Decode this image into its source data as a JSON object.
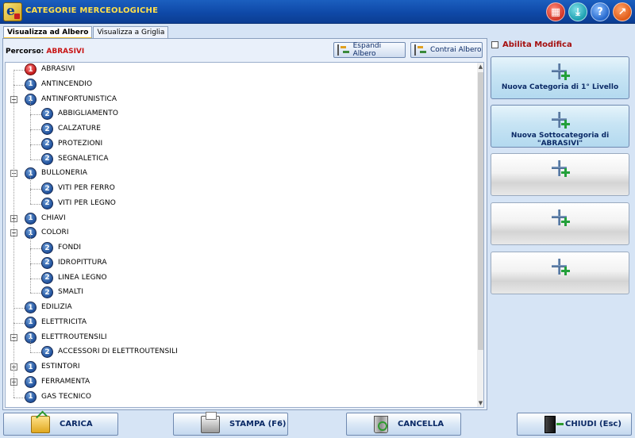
{
  "window": {
    "title": "CATEGORIE MERCEOLOGICHE",
    "buttons": {
      "calculator": "calculator-icon",
      "download": "download-icon",
      "help": "?",
      "exit": "exit-icon"
    }
  },
  "tabs": [
    {
      "label": "Visualizza ad Albero",
      "active": true
    },
    {
      "label": "Visualizza a Griglia",
      "active": false
    }
  ],
  "path": {
    "label": "Percorso:",
    "value": "ABRASIVI"
  },
  "toolbar": {
    "expand_label": "Espandi Albero",
    "collapse_label": "Contrai Albero"
  },
  "tree": [
    {
      "label": "ABRASIVI",
      "level": 1,
      "expander": null,
      "selected": true
    },
    {
      "label": "ANTINCENDIO",
      "level": 1,
      "expander": null
    },
    {
      "label": "ANTINFORTUNISTICA",
      "level": 1,
      "expander": "minus"
    },
    {
      "label": "ABBIGLIAMENTO",
      "level": 2
    },
    {
      "label": "CALZATURE",
      "level": 2
    },
    {
      "label": "PROTEZIONI",
      "level": 2
    },
    {
      "label": "SEGNALETICA",
      "level": 2
    },
    {
      "label": "BULLONERIA",
      "level": 1,
      "expander": "minus"
    },
    {
      "label": "VITI PER FERRO",
      "level": 2
    },
    {
      "label": "VITI PER LEGNO",
      "level": 2
    },
    {
      "label": "CHIAVI",
      "level": 1,
      "expander": "plus"
    },
    {
      "label": "COLORI",
      "level": 1,
      "expander": "minus"
    },
    {
      "label": "FONDI",
      "level": 2
    },
    {
      "label": "IDROPITTURA",
      "level": 2
    },
    {
      "label": "LINEA LEGNO",
      "level": 2
    },
    {
      "label": "SMALTI",
      "level": 2
    },
    {
      "label": "EDILIZIA",
      "level": 1,
      "expander": null
    },
    {
      "label": "ELETTRICITA",
      "level": 1,
      "expander": null
    },
    {
      "label": "ELETTROUTENSILI",
      "level": 1,
      "expander": "minus"
    },
    {
      "label": "ACCESSORI DI ELETTROUTENSILI",
      "level": 2
    },
    {
      "label": "ESTINTORI",
      "level": 1,
      "expander": "plus"
    },
    {
      "label": "FERRAMENTA",
      "level": 1,
      "expander": "plus"
    },
    {
      "label": "GAS TECNICO",
      "level": 1,
      "expander": null
    }
  ],
  "level_numbers": {
    "level1": "1",
    "level2": "2"
  },
  "right_panel": {
    "enable_edit_label": "Abilita Modifica",
    "new_category_label": "Nuova Categoria di 1° Livello",
    "new_subcategory_label": "Nuova Sottocategoria di \"ABRASIVI\""
  },
  "bottom": {
    "load_label": "CARICA",
    "print_label": "STAMPA (F6)",
    "delete_label": "CANCELLA",
    "close_label": "CHIUDI  (Esc)"
  }
}
